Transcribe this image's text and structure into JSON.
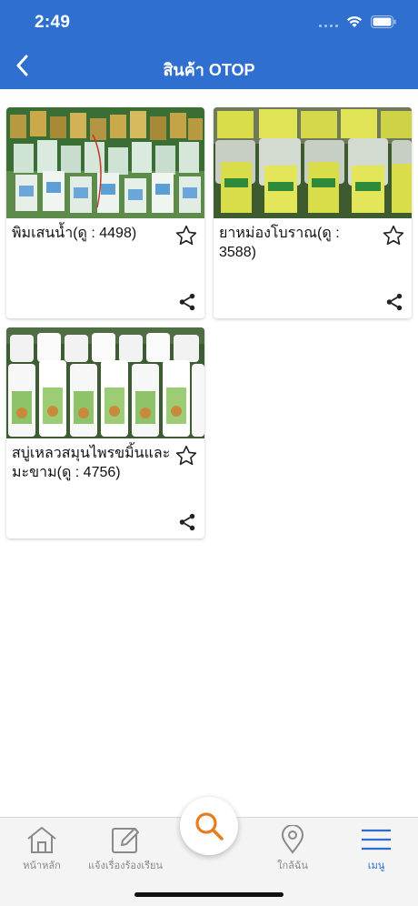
{
  "status_bar": {
    "time": "2:49"
  },
  "header": {
    "title": "สินค้า OTOP"
  },
  "products": [
    {
      "title": "พิมเสนน้ำ(ดู : 4498)"
    },
    {
      "title": "ยาหม่องโบราณ(ดู : 3588)"
    },
    {
      "title": "สบู่เหลวสมุนไพรขมิ้นและมะขาม(ดู : 4756)"
    }
  ],
  "tabbar": {
    "home": "หน้าหลัก",
    "report": "แจ้งเรื่องร้องเรียน",
    "nearby": "ใกล้ฉัน",
    "menu": "เมนู"
  },
  "colors": {
    "header": "#2f6fd0",
    "accent_search": "#e87d1e",
    "active_tab": "#2a6fd0",
    "inactive_tab": "#8a8a8a"
  },
  "icons": [
    "chevron-left-icon",
    "star-outline-icon",
    "share-icon",
    "home-icon",
    "edit-icon",
    "search-icon",
    "location-pin-icon",
    "hamburger-menu-icon"
  ]
}
